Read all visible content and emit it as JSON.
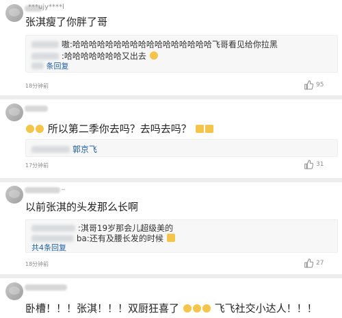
{
  "comments": [
    {
      "username": "***ujy****l",
      "text": "张淇瘦了你胖了哥",
      "replies": [
        {
          "text": "嗷:哈哈哈哈哈哈哈哈哈哈哈哈哈哈哈哈哈飞哥看见给你拉黑"
        },
        {
          "text": ":哈哈哈哈哈哈哈又出去"
        }
      ],
      "more_text": "条回复",
      "time": "18分钟前",
      "likes": "95"
    },
    {
      "username": "",
      "text": "所以第二季你去吗？去吗去吗？",
      "replies": [
        {
          "text": "郭京飞"
        }
      ],
      "more_text": "",
      "time": "17分钟前",
      "likes": "31"
    },
    {
      "username": "_",
      "text": "以前张淇的头发那么长啊",
      "replies": [
        {
          "text": ":淇哥19岁那会儿超级美的"
        },
        {
          "text": "ba:还有及腰长发的时候"
        }
      ],
      "more_text": "共4条回复",
      "time": "18分钟前",
      "likes": "27"
    },
    {
      "username": "",
      "text_a": "卧槽！！！张淇！！！双厨狂喜了",
      "text_b": "飞飞社交小达人！！！"
    }
  ],
  "colors": {
    "background": "#f4f4f4",
    "card": "#ffffff",
    "reply_bg": "#f7f7f7",
    "link": "#1f5fa3",
    "meta": "#8b8b8b",
    "emoji": "#f5c54b"
  },
  "icons": [
    "thumbs-up-icon",
    "emoji-icon",
    "avatar"
  ]
}
